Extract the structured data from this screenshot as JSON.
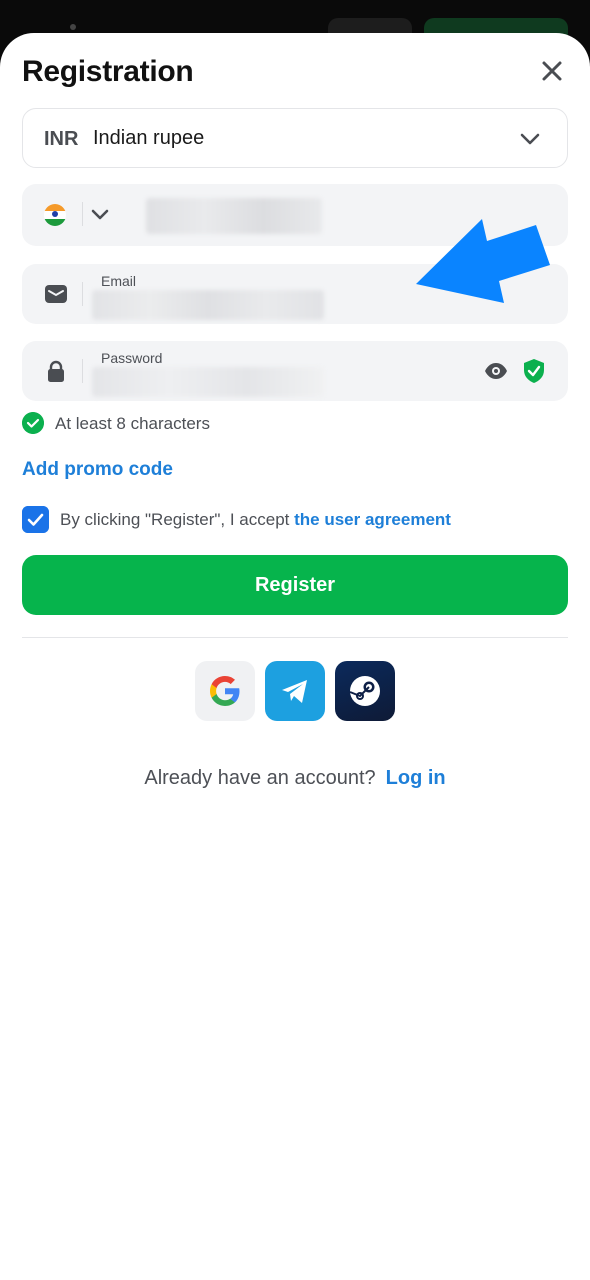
{
  "header": {
    "title": "Registration"
  },
  "currency": {
    "code": "INR",
    "name": "Indian rupee"
  },
  "phone": {
    "country_flag": "india-flag"
  },
  "email": {
    "label": "Email"
  },
  "password": {
    "label": "Password"
  },
  "password_hint": {
    "text": "At least 8 characters"
  },
  "promo": {
    "label": "Add promo code"
  },
  "agreement": {
    "prefix": "By clicking \"Register\", I accept",
    "link": "the user agreement",
    "checked": true
  },
  "register_button": {
    "label": "Register"
  },
  "social": {
    "providers": [
      "google",
      "telegram",
      "steam"
    ]
  },
  "login_prompt": {
    "text": "Already have an account?",
    "link": "Log in"
  },
  "colors": {
    "accent_green": "#06b44c",
    "link_blue": "#1e7fd8",
    "arrow_blue": "#0a84ff"
  }
}
